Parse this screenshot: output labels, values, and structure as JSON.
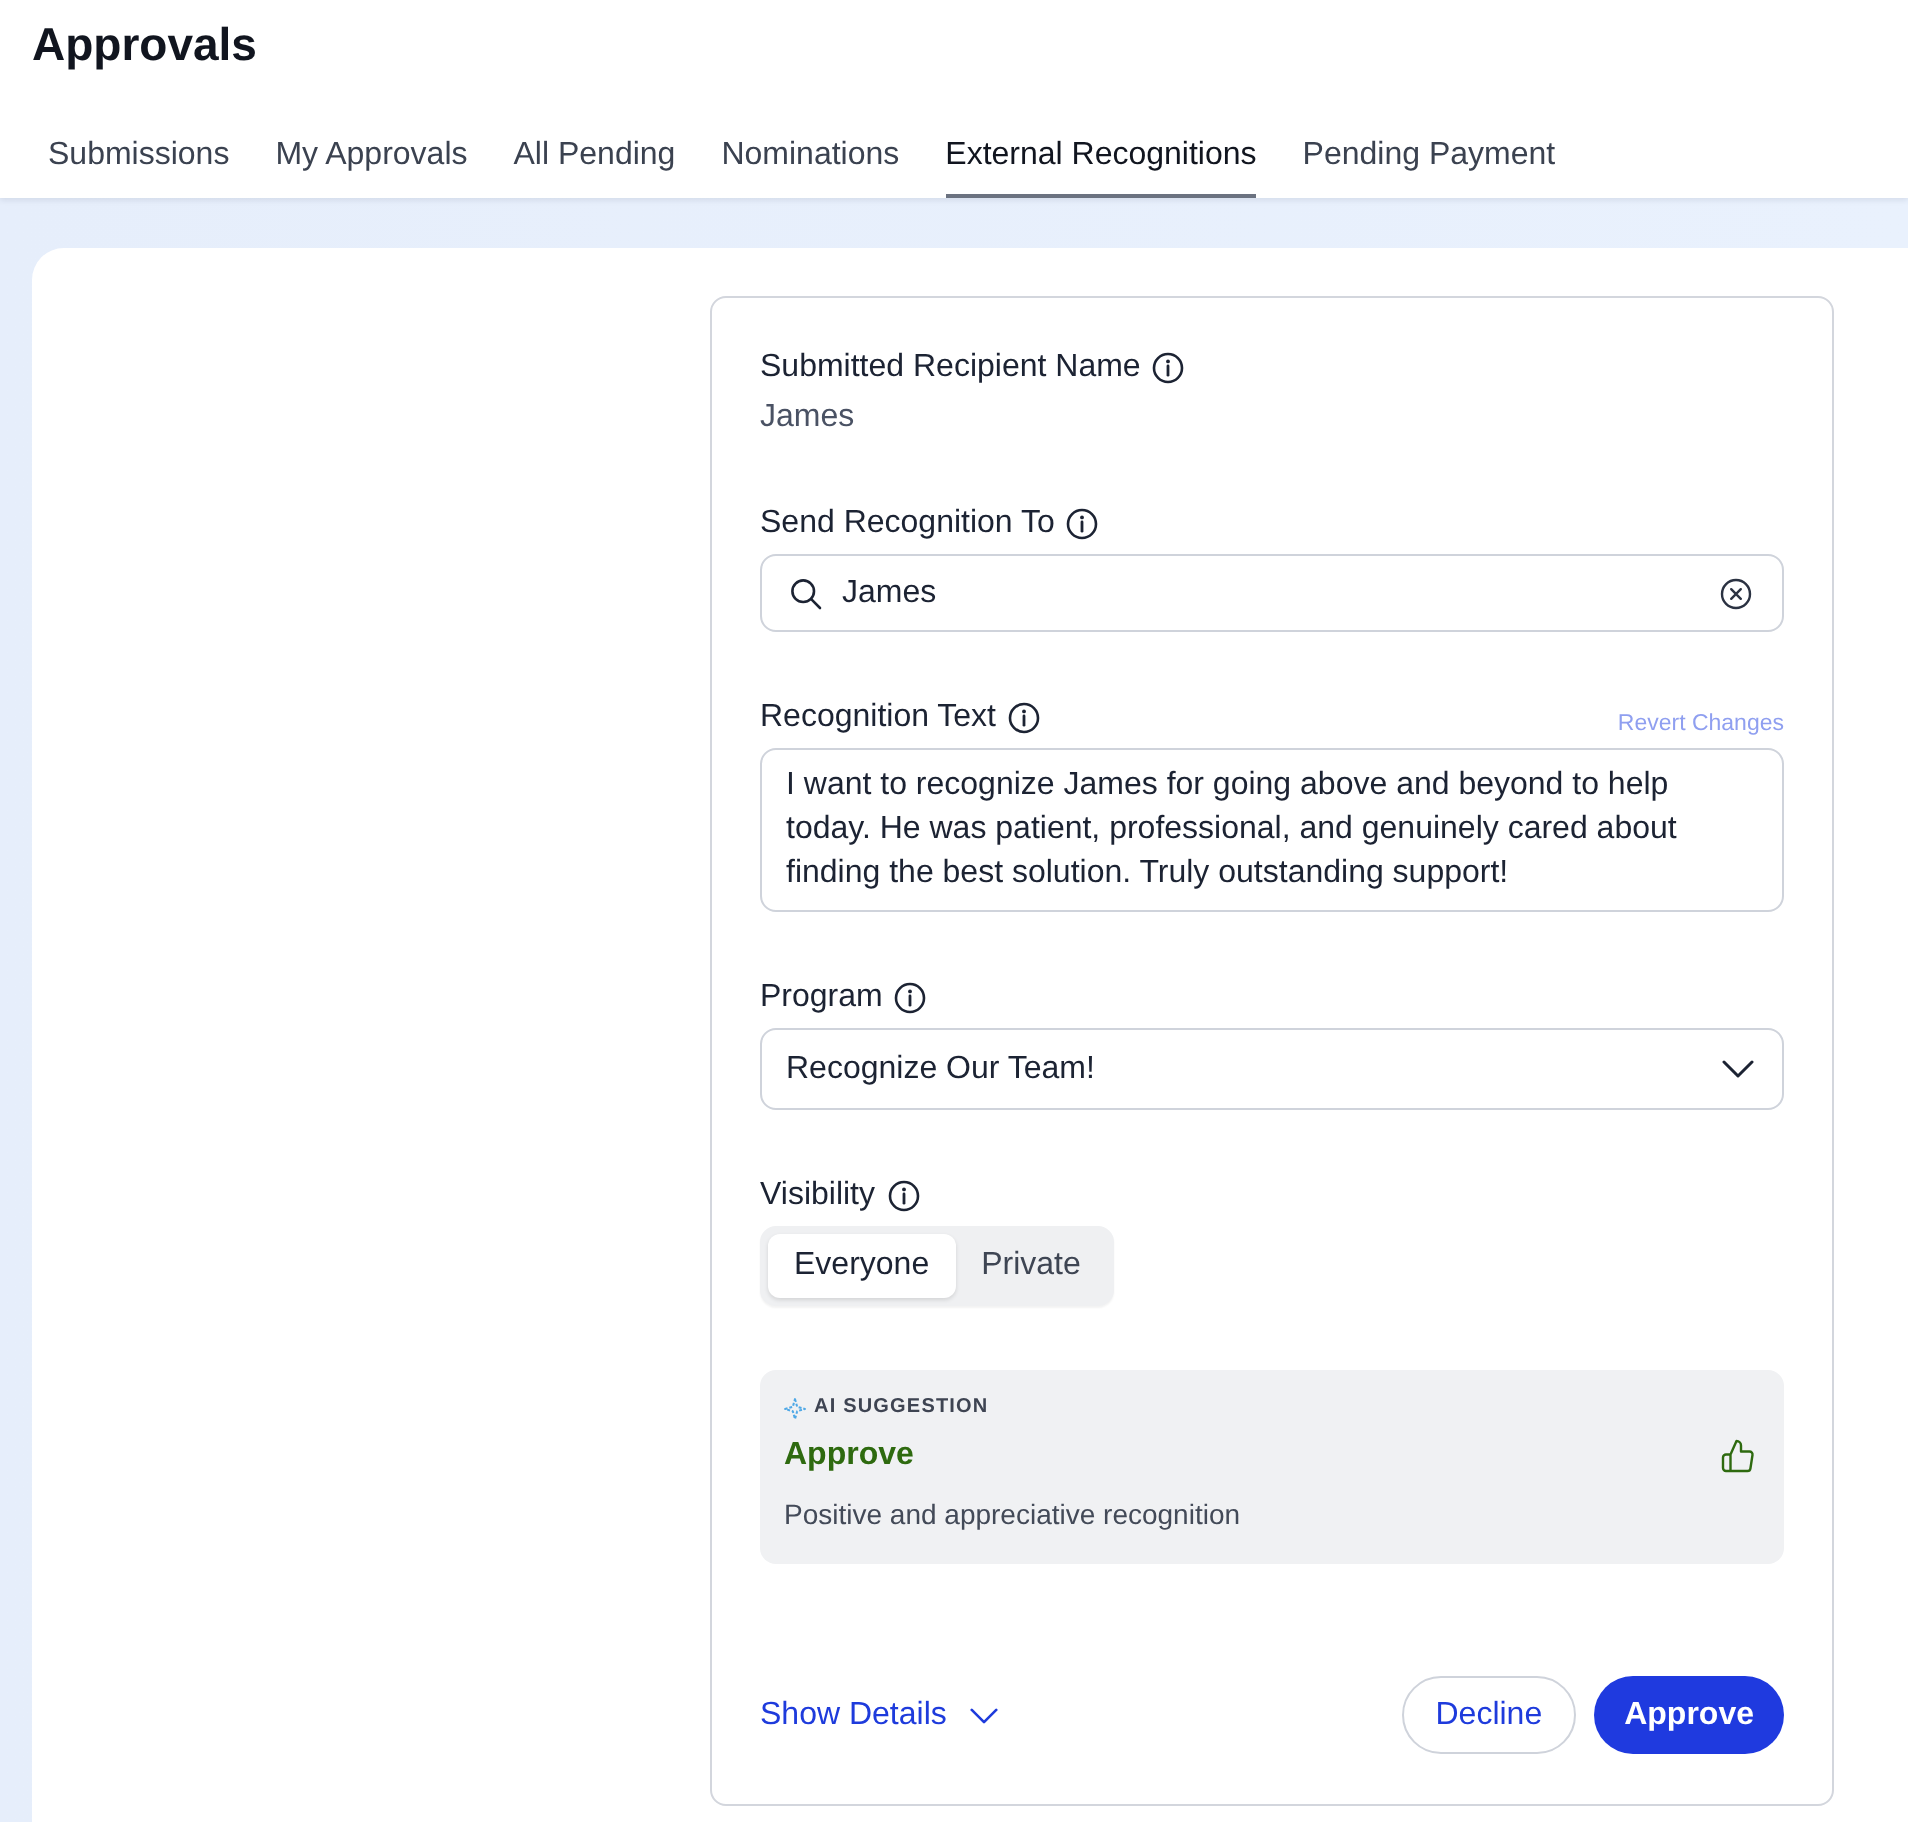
{
  "page": {
    "title": "Approvals"
  },
  "tabs": [
    {
      "label": "Submissions",
      "selected": false
    },
    {
      "label": "My Approvals",
      "selected": false
    },
    {
      "label": "All Pending",
      "selected": false
    },
    {
      "label": "Nominations",
      "selected": false
    },
    {
      "label": "External Recognitions",
      "selected": true
    },
    {
      "label": "Pending Payment",
      "selected": false
    }
  ],
  "form": {
    "fields": [
      {
        "kind": "text",
        "label": "Submitted Recipient Name",
        "value": "James"
      },
      {
        "kind": "search",
        "label": "Send Recognition To",
        "value": "James"
      },
      {
        "kind": "textarea",
        "label": "Recognition Text",
        "action": "Revert Changes",
        "value": "I want to recognize James for going above and beyond to help today. He was patient, professional, and genuinely cared about finding the best solution. Truly outstanding support!"
      },
      {
        "kind": "select",
        "label": "Program",
        "value": "Recognize Our Team!"
      },
      {
        "kind": "segmented",
        "label": "Visibility",
        "options": [
          {
            "label": "Everyone",
            "selected": true
          },
          {
            "label": "Private",
            "selected": false
          }
        ]
      }
    ]
  },
  "ai_suggestion": {
    "heading": "AI SUGGESTION",
    "verdict": "Approve",
    "reason": "Positive and appreciative recognition"
  },
  "footer": {
    "link": "Show Details",
    "buttons": [
      {
        "kind": "secondary",
        "label": "Decline"
      },
      {
        "kind": "primary",
        "label": "Approve"
      }
    ]
  }
}
